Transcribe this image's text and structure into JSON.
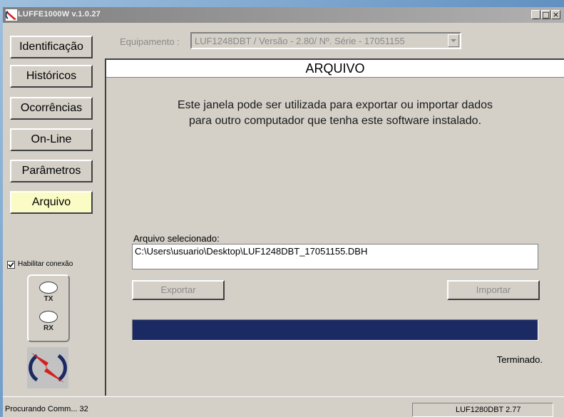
{
  "window": {
    "title": "LUFFE1000W v.1.0.27",
    "minimize_glyph": "_",
    "maximize_glyph": "□",
    "close_glyph": "×"
  },
  "nav": {
    "items": [
      {
        "label": "Identificação"
      },
      {
        "label": "Históricos"
      },
      {
        "label": "Ocorrências"
      },
      {
        "label": "On-Line"
      },
      {
        "label": "Parâmetros"
      },
      {
        "label": "Arquivo",
        "active": true
      }
    ]
  },
  "equipment": {
    "label": "Equipamento :",
    "selected": "LUF1248DBT / Versão - 2.80/ Nº. Série - 17051155"
  },
  "panel": {
    "header": "ARQUIVO",
    "description_line1": "Este janela pode ser utilizada para exportar ou importar dados",
    "description_line2": "para outro computador que tenha este software instalado.",
    "file_label": "Arquivo selecionado:",
    "file_value": "C:\\Users\\usuario\\Desktop\\LUF1248DBT_17051155.DBH",
    "export_label": "Exportar",
    "import_label": "Importar",
    "progress": 1.0,
    "status": "Terminado."
  },
  "connection": {
    "enable_label": "Habilitar conexão",
    "enabled": true,
    "tx_label": "TX",
    "rx_label": "RX"
  },
  "statusbar": {
    "left": "Procurando Comm... 32",
    "right": "LUF1280DBT 2.77"
  },
  "colors": {
    "active_nav": "#fbfbc5",
    "progress_fill": "#1c2a63",
    "logo_red": "#d42020",
    "logo_navy": "#1c2a63"
  }
}
